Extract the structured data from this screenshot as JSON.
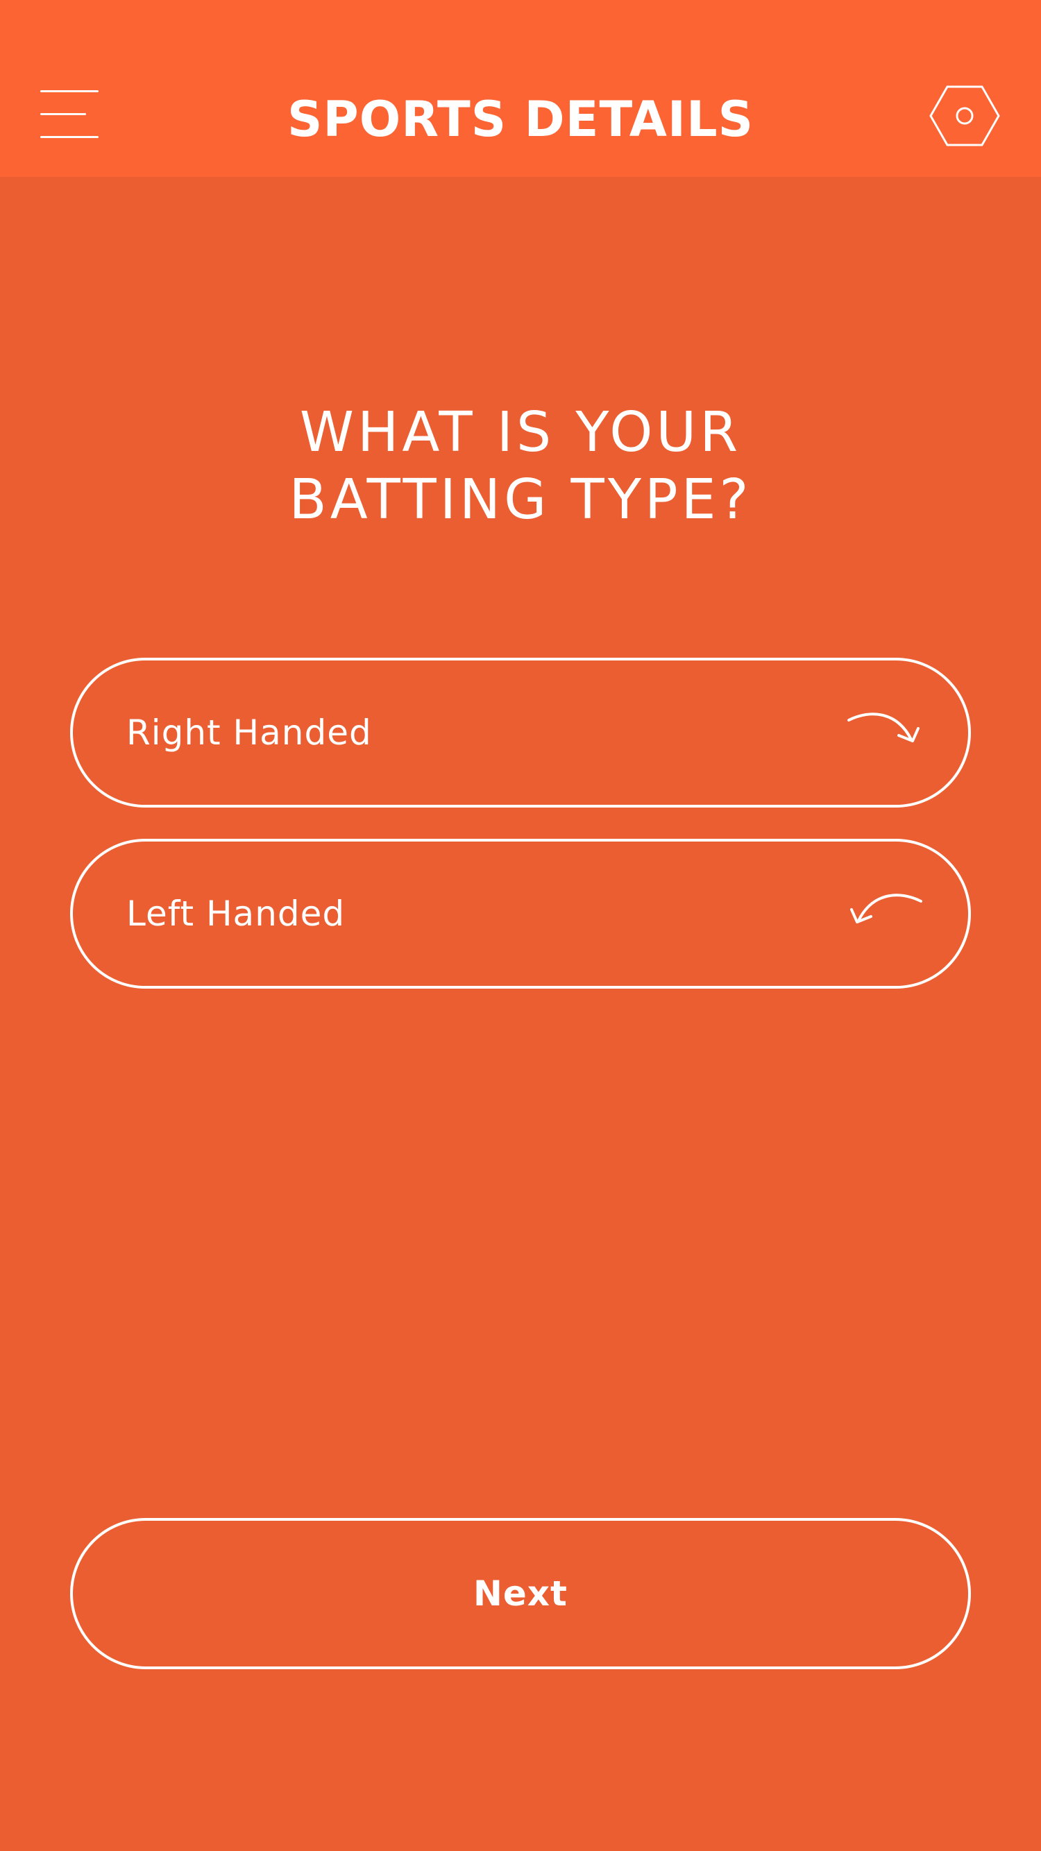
{
  "header": {
    "title": "SPORTS DETAILS",
    "menu_icon": "hamburger-menu-icon",
    "settings_icon": "hexagon-settings-icon"
  },
  "question": {
    "line1": "WHAT IS YOUR",
    "line2": "BATTING TYPE?"
  },
  "options": [
    {
      "label": "Right Handed",
      "icon": "curved-arrow-right-icon"
    },
    {
      "label": "Left Handed",
      "icon": "curved-arrow-left-icon"
    }
  ],
  "next_label": "Next",
  "colors": {
    "header_background": "#FC6434",
    "page_background": "#EB5E31",
    "foreground": "#FFFFFF"
  }
}
